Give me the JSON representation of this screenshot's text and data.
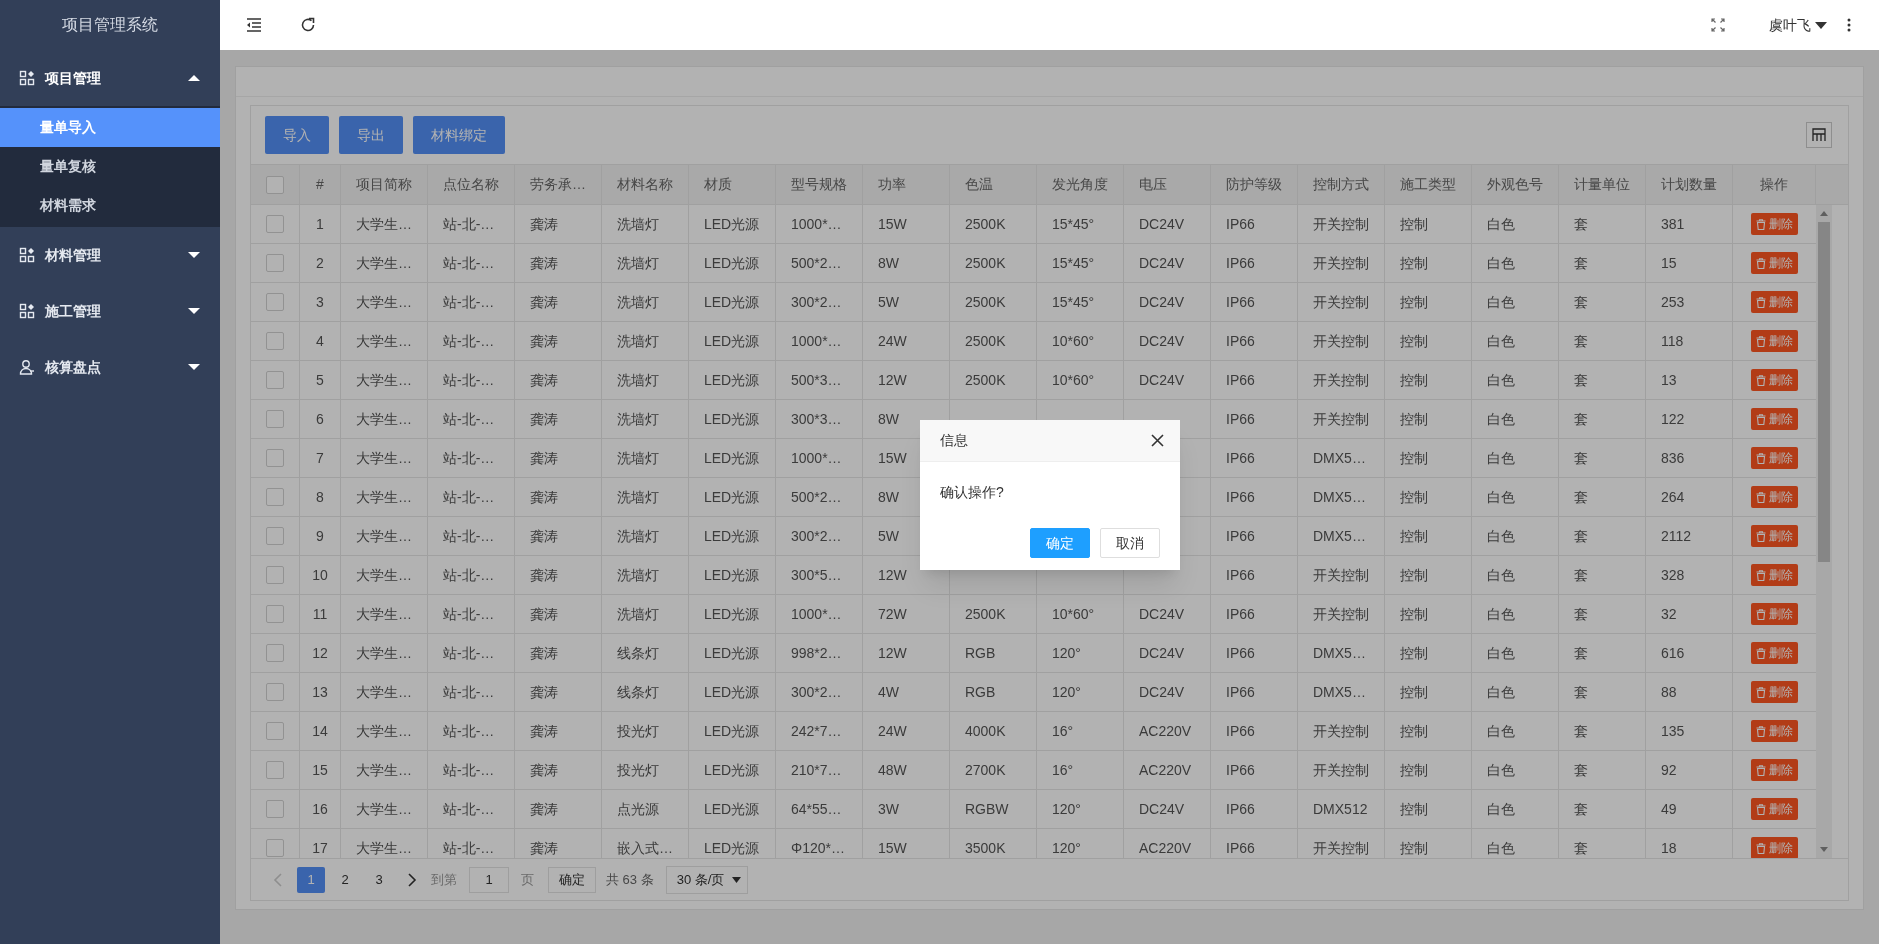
{
  "app_title": "项目管理系统",
  "sidebar": {
    "items": [
      {
        "label": "项目管理",
        "expanded": true,
        "children": [
          {
            "label": "量单导入",
            "selected": true
          },
          {
            "label": "量单复核",
            "selected": false
          },
          {
            "label": "材料需求",
            "selected": false
          }
        ]
      },
      {
        "label": "材料管理",
        "expanded": false
      },
      {
        "label": "施工管理",
        "expanded": false
      },
      {
        "label": "核算盘点",
        "expanded": false
      }
    ]
  },
  "header": {
    "user": "虞叶飞"
  },
  "toolbar": {
    "buttons": [
      "导入",
      "导出",
      "材料绑定"
    ]
  },
  "table": {
    "select_all": {
      "checked": false
    },
    "columns": [
      "#",
      "项目简称",
      "点位名称",
      "劳务承…",
      "材料名称",
      "材质",
      "型号规格",
      "功率",
      "色温",
      "发光角度",
      "电压",
      "防护等级",
      "控制方式",
      "施工类型",
      "外观色号",
      "计量单位",
      "计划数量",
      "操作"
    ],
    "rows": [
      {
        "checked": false,
        "cells": [
          "1",
          "大学生…",
          "站-北-…",
          "龚涛",
          "洗墙灯",
          "LED光源",
          "1000*…",
          "15W",
          "2500K",
          "15*45°",
          "DC24V",
          "IP66",
          "开关控制",
          "控制",
          "白色",
          "套",
          "381"
        ],
        "action": "删除"
      },
      {
        "checked": false,
        "cells": [
          "2",
          "大学生…",
          "站-北-…",
          "龚涛",
          "洗墙灯",
          "LED光源",
          "500*2…",
          "8W",
          "2500K",
          "15*45°",
          "DC24V",
          "IP66",
          "开关控制",
          "控制",
          "白色",
          "套",
          "15"
        ],
        "action": "删除"
      },
      {
        "checked": false,
        "cells": [
          "3",
          "大学生…",
          "站-北-…",
          "龚涛",
          "洗墙灯",
          "LED光源",
          "300*2…",
          "5W",
          "2500K",
          "15*45°",
          "DC24V",
          "IP66",
          "开关控制",
          "控制",
          "白色",
          "套",
          "253"
        ],
        "action": "删除"
      },
      {
        "checked": false,
        "cells": [
          "4",
          "大学生…",
          "站-北-…",
          "龚涛",
          "洗墙灯",
          "LED光源",
          "1000*…",
          "24W",
          "2500K",
          "10*60°",
          "DC24V",
          "IP66",
          "开关控制",
          "控制",
          "白色",
          "套",
          "118"
        ],
        "action": "删除"
      },
      {
        "checked": false,
        "cells": [
          "5",
          "大学生…",
          "站-北-…",
          "龚涛",
          "洗墙灯",
          "LED光源",
          "500*3…",
          "12W",
          "2500K",
          "10*60°",
          "DC24V",
          "IP66",
          "开关控制",
          "控制",
          "白色",
          "套",
          "13"
        ],
        "action": "删除"
      },
      {
        "checked": false,
        "cells": [
          "6",
          "大学生…",
          "站-北-…",
          "龚涛",
          "洗墙灯",
          "LED光源",
          "300*3…",
          "8W",
          null,
          null,
          null,
          "IP66",
          "开关控制",
          "控制",
          "白色",
          "套",
          "122"
        ],
        "action": "删除"
      },
      {
        "checked": false,
        "cells": [
          "7",
          "大学生…",
          "站-北-…",
          "龚涛",
          "洗墙灯",
          "LED光源",
          "1000*…",
          "15W",
          null,
          null,
          null,
          "IP66",
          "DMX5…",
          "控制",
          "白色",
          "套",
          "836"
        ],
        "action": "删除"
      },
      {
        "checked": false,
        "cells": [
          "8",
          "大学生…",
          "站-北-…",
          "龚涛",
          "洗墙灯",
          "LED光源",
          "500*2…",
          "8W",
          null,
          null,
          null,
          "IP66",
          "DMX5…",
          "控制",
          "白色",
          "套",
          "264"
        ],
        "action": "删除"
      },
      {
        "checked": false,
        "cells": [
          "9",
          "大学生…",
          "站-北-…",
          "龚涛",
          "洗墙灯",
          "LED光源",
          "300*2…",
          "5W",
          null,
          null,
          null,
          "IP66",
          "DMX5…",
          "控制",
          "白色",
          "套",
          "2112"
        ],
        "action": "删除"
      },
      {
        "checked": false,
        "cells": [
          "10",
          "大学生…",
          "站-北-…",
          "龚涛",
          "洗墙灯",
          "LED光源",
          "300*5…",
          "12W",
          null,
          null,
          null,
          "IP66",
          "开关控制",
          "控制",
          "白色",
          "套",
          "328"
        ],
        "action": "删除"
      },
      {
        "checked": false,
        "cells": [
          "11",
          "大学生…",
          "站-北-…",
          "龚涛",
          "洗墙灯",
          "LED光源",
          "1000*…",
          "72W",
          "2500K",
          "10*60°",
          "DC24V",
          "IP66",
          "开关控制",
          "控制",
          "白色",
          "套",
          "32"
        ],
        "action": "删除"
      },
      {
        "checked": false,
        "cells": [
          "12",
          "大学生…",
          "站-北-…",
          "龚涛",
          "线条灯",
          "LED光源",
          "998*2…",
          "12W",
          "RGB",
          "120°",
          "DC24V",
          "IP66",
          "DMX5…",
          "控制",
          "白色",
          "套",
          "616"
        ],
        "action": "删除"
      },
      {
        "checked": false,
        "cells": [
          "13",
          "大学生…",
          "站-北-…",
          "龚涛",
          "线条灯",
          "LED光源",
          "300*2…",
          "4W",
          "RGB",
          "120°",
          "DC24V",
          "IP66",
          "DMX5…",
          "控制",
          "白色",
          "套",
          "88"
        ],
        "action": "删除"
      },
      {
        "checked": false,
        "cells": [
          "14",
          "大学生…",
          "站-北-…",
          "龚涛",
          "投光灯",
          "LED光源",
          "242*7…",
          "24W",
          "4000K",
          "16°",
          "AC220V",
          "IP66",
          "开关控制",
          "控制",
          "白色",
          "套",
          "135"
        ],
        "action": "删除"
      },
      {
        "checked": false,
        "cells": [
          "15",
          "大学生…",
          "站-北-…",
          "龚涛",
          "投光灯",
          "LED光源",
          "210*7…",
          "48W",
          "2700K",
          "16°",
          "AC220V",
          "IP66",
          "开关控制",
          "控制",
          "白色",
          "套",
          "92"
        ],
        "action": "删除"
      },
      {
        "checked": false,
        "cells": [
          "16",
          "大学生…",
          "站-北-…",
          "龚涛",
          "点光源",
          "LED光源",
          "64*55…",
          "3W",
          "RGBW",
          "120°",
          "DC24V",
          "IP66",
          "DMX512",
          "控制",
          "白色",
          "套",
          "49"
        ],
        "action": "删除"
      },
      {
        "checked": false,
        "cells": [
          "17",
          "大学生…",
          "站-北-…",
          "龚涛",
          "嵌入式…",
          "LED光源",
          "Φ120*…",
          "15W",
          "3500K",
          "120°",
          "AC220V",
          "IP66",
          "开关控制",
          "控制",
          "白色",
          "套",
          "18"
        ],
        "action": "删除"
      }
    ]
  },
  "pagination": {
    "pages": [
      {
        "label": "1",
        "selected": true
      },
      {
        "label": "2",
        "selected": false
      },
      {
        "label": "3",
        "selected": false
      }
    ],
    "goto_label": "到第",
    "goto_value": "1",
    "page_label": "页",
    "confirm": "确定",
    "total": "共 63 条",
    "page_size": "30 条/页"
  },
  "dialog": {
    "title": "信息",
    "message": "确认操作?",
    "buttons": [
      {
        "label": "确定",
        "kind": "primary"
      },
      {
        "label": "取消",
        "kind": "secondary"
      }
    ]
  }
}
